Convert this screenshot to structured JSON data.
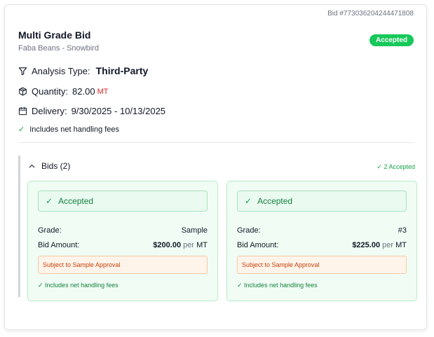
{
  "header": {
    "bid_id": "Bid #773036204244471808",
    "title": "Multi Grade Bid",
    "subtitle": "Faba Beans - Snowbird",
    "status": "Accepted"
  },
  "details": {
    "analysis_label": "Analysis Type:",
    "analysis_value": "Third-Party",
    "quantity_label": "Quantity:",
    "quantity_value": "82.00",
    "quantity_unit": "MT",
    "delivery_label": "Delivery:",
    "delivery_value": "9/30/2025 - 10/13/2025",
    "fees_note": "Includes net handling fees"
  },
  "bids": {
    "header_label": "Bids (2)",
    "accepted_summary": "✓ 2 Accepted",
    "items": [
      {
        "status": "Accepted",
        "grade_label": "Grade:",
        "grade_value": "Sample",
        "amount_label": "Bid Amount:",
        "amount_value": "$200.00",
        "amount_per": "per",
        "amount_unit": "MT",
        "approval_note": "Subject to Sample Approval",
        "fees_note": "✓ Includes net handling fees"
      },
      {
        "status": "Accepted",
        "grade_label": "Grade:",
        "grade_value": "#3",
        "amount_label": "Bid Amount:",
        "amount_value": "$225.00",
        "amount_per": "per",
        "amount_unit": "MT",
        "approval_note": "Subject to Sample Approval",
        "fees_note": "✓ Includes net handling fees"
      }
    ]
  },
  "colors": {
    "accent_green": "#16c95a",
    "unit_red": "#dc2626",
    "warning_orange": "#c2410c"
  }
}
